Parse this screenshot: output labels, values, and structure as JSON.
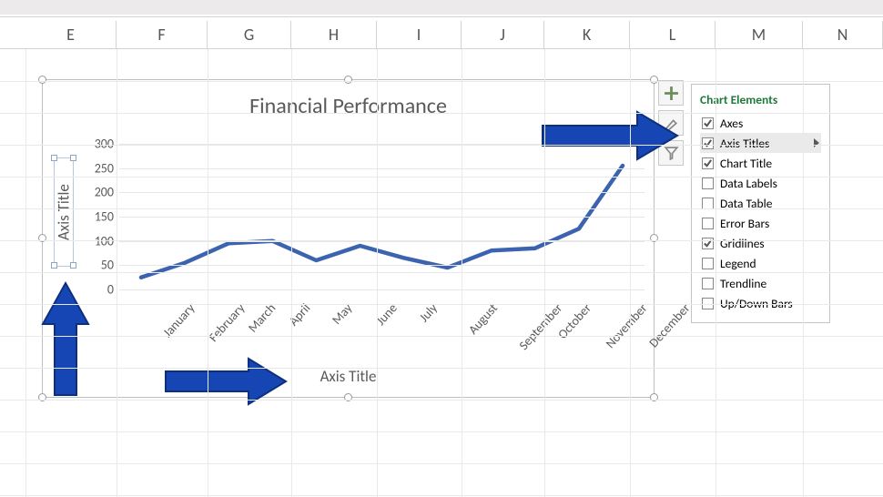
{
  "columns": [
    "E",
    "F",
    "G",
    "H",
    "I",
    "J",
    "K",
    "L",
    "M",
    "N"
  ],
  "chart": {
    "title": "Financial Performance",
    "yaxis_title": "Axis Title",
    "xaxis_title": "Axis Title",
    "y_ticks": [
      "0",
      "50",
      "100",
      "150",
      "200",
      "250",
      "300"
    ]
  },
  "flyout": {
    "title": "Chart Elements",
    "items": [
      {
        "label": "Axes",
        "checked": true
      },
      {
        "label": "Axis Titles",
        "checked": true,
        "hover": true,
        "submenu": true
      },
      {
        "label": "Chart Title",
        "checked": true
      },
      {
        "label": "Data Labels",
        "checked": false
      },
      {
        "label": "Data Table",
        "checked": false
      },
      {
        "label": "Error Bars",
        "checked": false
      },
      {
        "label": "Gridlines",
        "checked": true
      },
      {
        "label": "Legend",
        "checked": false
      },
      {
        "label": "Trendline",
        "checked": false
      },
      {
        "label": "Up/Down Bars",
        "checked": false
      }
    ]
  },
  "chart_data": {
    "type": "line",
    "title": "Financial Performance",
    "xlabel": "Axis Title",
    "ylabel": "Axis Title",
    "categories": [
      "January",
      "February",
      "March",
      "April",
      "May",
      "June",
      "July",
      "August",
      "September",
      "October",
      "November",
      "December"
    ],
    "values": [
      25,
      55,
      95,
      100,
      60,
      90,
      65,
      45,
      80,
      85,
      125,
      255
    ],
    "ylim": [
      0,
      300
    ],
    "grid": true,
    "legend": false
  }
}
